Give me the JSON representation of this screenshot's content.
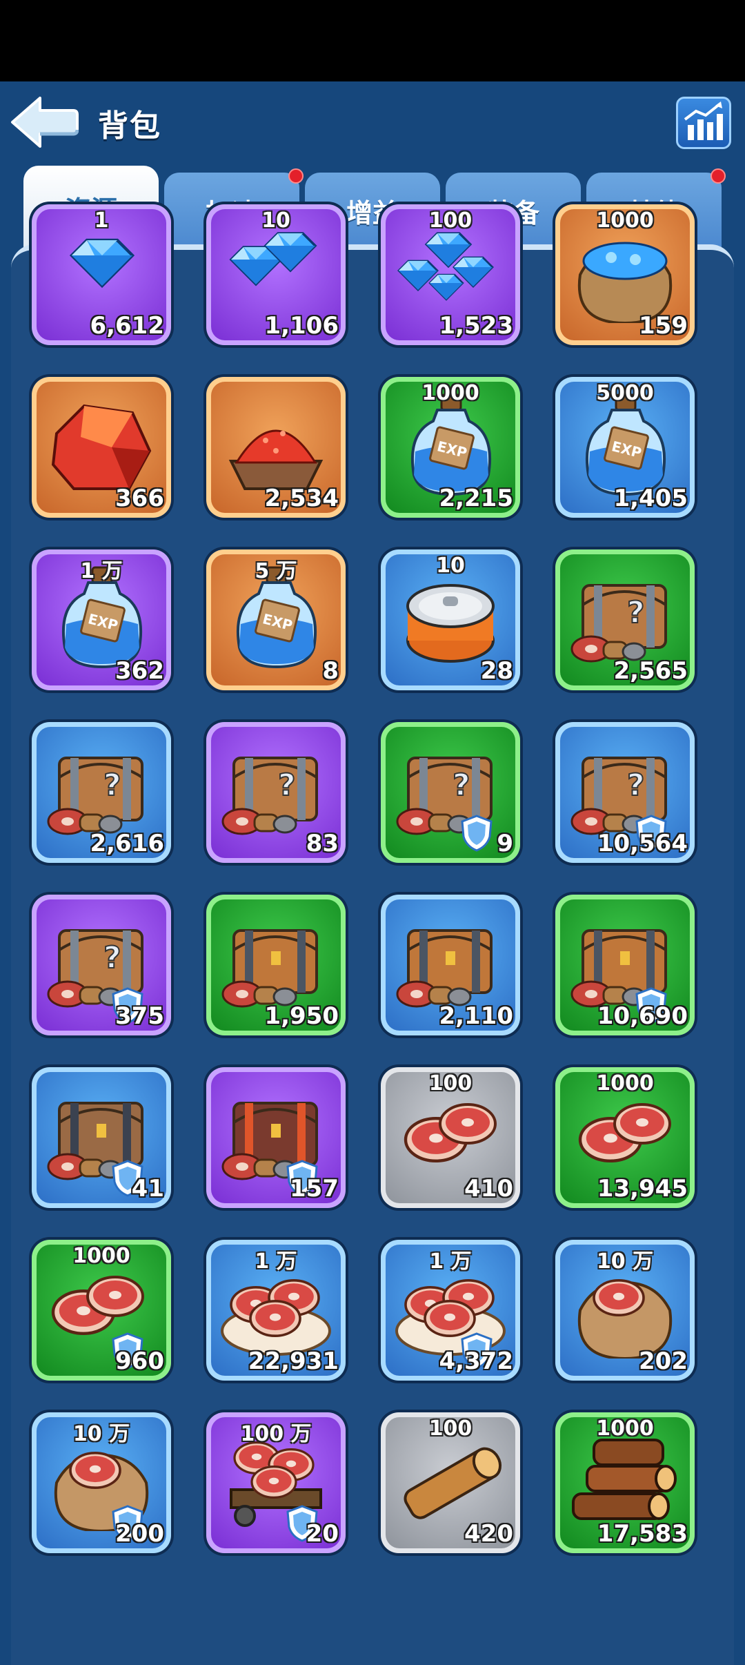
{
  "header": {
    "title": "背包"
  },
  "tabs": [
    {
      "label": "资源",
      "active": true,
      "dot": false
    },
    {
      "label": "加速",
      "active": false,
      "dot": true
    },
    {
      "label": "增益",
      "active": false,
      "dot": false
    },
    {
      "label": "装备",
      "active": false,
      "dot": false
    },
    {
      "label": "其他",
      "active": false,
      "dot": true
    }
  ],
  "items": [
    {
      "icon": "gem-single-icon",
      "rarity": "purple",
      "value": "1",
      "qty": "6,612"
    },
    {
      "icon": "gem-pile-icon",
      "rarity": "purple",
      "value": "10",
      "qty": "1,106"
    },
    {
      "icon": "gem-cluster-icon",
      "rarity": "purple",
      "value": "100",
      "qty": "1,523"
    },
    {
      "icon": "gem-sack-icon",
      "rarity": "orange",
      "value": "1000",
      "qty": "159"
    },
    {
      "icon": "red-ore-icon",
      "rarity": "orange",
      "value": "",
      "qty": "366"
    },
    {
      "icon": "red-ore-crate-icon",
      "rarity": "orange",
      "value": "",
      "qty": "2,534"
    },
    {
      "icon": "exp-potion-icon",
      "rarity": "green",
      "value": "1000",
      "qty": "2,215"
    },
    {
      "icon": "exp-potion-icon",
      "rarity": "blue",
      "value": "5000",
      "qty": "1,405"
    },
    {
      "icon": "exp-potion-icon",
      "rarity": "purple",
      "value": "1 万",
      "qty": "362"
    },
    {
      "icon": "exp-potion-icon",
      "rarity": "orange",
      "value": "5 万",
      "qty": "8"
    },
    {
      "icon": "canned-food-icon",
      "rarity": "blue",
      "value": "10",
      "qty": "28"
    },
    {
      "icon": "mystery-chest-icon",
      "rarity": "green",
      "value": "",
      "qty": "2,565"
    },
    {
      "icon": "mystery-chest-icon",
      "rarity": "blue",
      "value": "",
      "qty": "2,616"
    },
    {
      "icon": "mystery-chest-icon",
      "rarity": "purple",
      "value": "",
      "qty": "83"
    },
    {
      "icon": "mystery-chest-shield-icon",
      "rarity": "green",
      "value": "",
      "qty": "9"
    },
    {
      "icon": "mystery-chest-shield-icon",
      "rarity": "blue",
      "value": "",
      "qty": "10,564"
    },
    {
      "icon": "mystery-chest-shield-icon",
      "rarity": "purple",
      "value": "",
      "qty": "375"
    },
    {
      "icon": "resource-chest-icon",
      "rarity": "green",
      "value": "",
      "qty": "1,950"
    },
    {
      "icon": "resource-chest-icon",
      "rarity": "blue",
      "value": "",
      "qty": "2,110"
    },
    {
      "icon": "resource-chest-shield-icon",
      "rarity": "green",
      "value": "",
      "qty": "10,690"
    },
    {
      "icon": "dark-chest-shield-icon",
      "rarity": "blue",
      "value": "",
      "qty": "41"
    },
    {
      "icon": "red-chest-shield-icon",
      "rarity": "purple",
      "value": "",
      "qty": "157"
    },
    {
      "icon": "meat-icon",
      "rarity": "gray",
      "value": "100",
      "qty": "410"
    },
    {
      "icon": "meat-icon",
      "rarity": "green",
      "value": "1000",
      "qty": "13,945"
    },
    {
      "icon": "meat-shield-icon",
      "rarity": "green",
      "value": "1000",
      "qty": "960"
    },
    {
      "icon": "meat-plate-icon",
      "rarity": "blue",
      "value": "1 万",
      "qty": "22,931"
    },
    {
      "icon": "meat-plate-shield-icon",
      "rarity": "blue",
      "value": "1 万",
      "qty": "4,372"
    },
    {
      "icon": "meat-sack-icon",
      "rarity": "blue",
      "value": "10 万",
      "qty": "202"
    },
    {
      "icon": "meat-sack-shield-icon",
      "rarity": "blue",
      "value": "10 万",
      "qty": "200"
    },
    {
      "icon": "meat-cart-shield-icon",
      "rarity": "purple",
      "value": "100 万",
      "qty": "20"
    },
    {
      "icon": "wood-log-icon",
      "rarity": "gray",
      "value": "100",
      "qty": "420"
    },
    {
      "icon": "wood-pile-icon",
      "rarity": "green",
      "value": "1000",
      "qty": "17,583"
    }
  ]
}
